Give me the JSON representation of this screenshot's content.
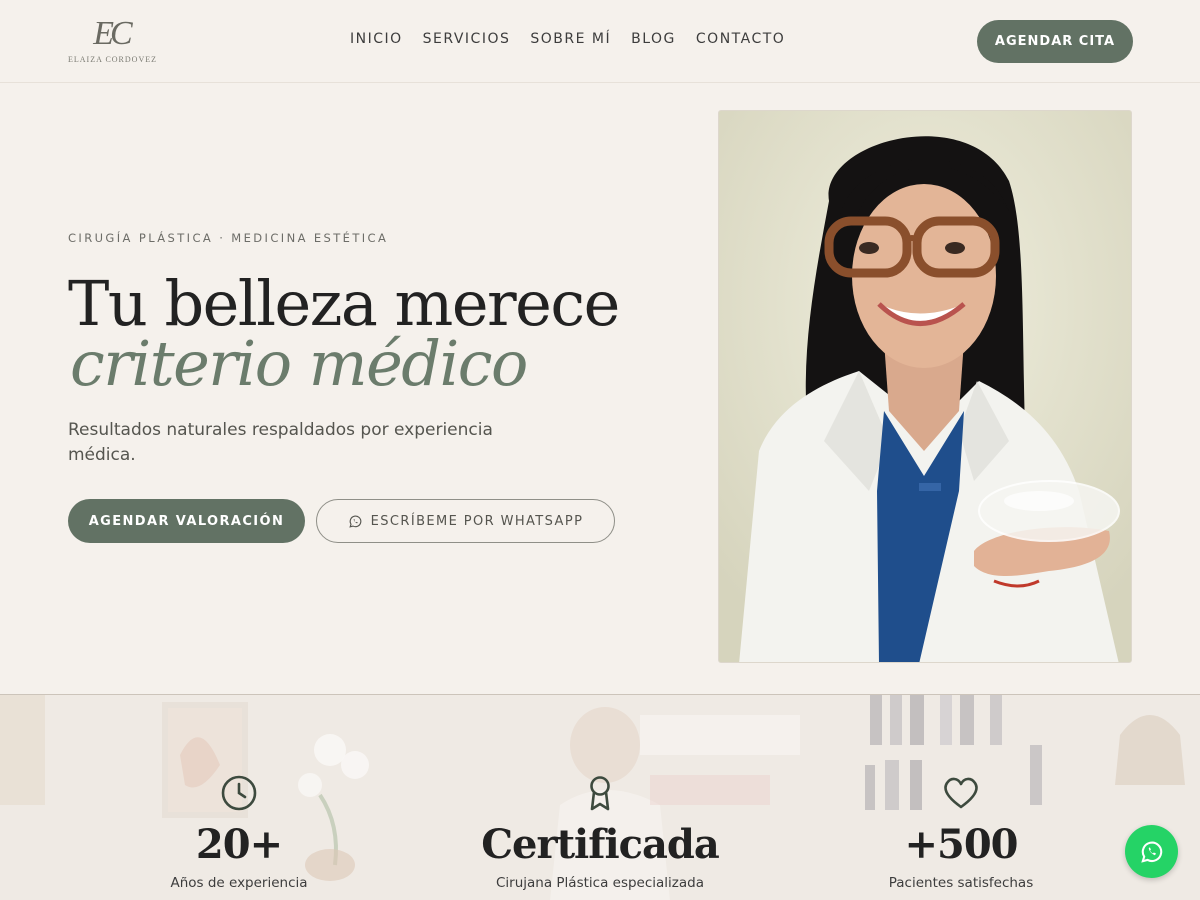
{
  "header": {
    "logo_mark": "EC",
    "logo_name": "ELAIZA CORDOVEZ",
    "nav": [
      "INICIO",
      "SERVICIOS",
      "SOBRE MÍ",
      "BLOG",
      "CONTACTO"
    ],
    "cta": "AGENDAR CITA"
  },
  "hero": {
    "eyebrow": "CIRUGÍA PLÁSTICA · MEDICINA ESTÉTICA",
    "title_line1": "Tu belleza merece",
    "title_line2": "criterio médico",
    "subtitle": "Resultados naturales respaldados por experiencia médica.",
    "primary_button": "AGENDAR VALORACIÓN",
    "secondary_button": "ESCRÍBEME POR WHATSAPP",
    "secondary_icon": "whatsapp-icon"
  },
  "stats": [
    {
      "icon": "clock-icon",
      "value": "20+",
      "label": "Años de experiencia"
    },
    {
      "icon": "award-icon",
      "value": "Certificada",
      "label": "Cirujana Plástica especializada"
    },
    {
      "icon": "heart-icon",
      "value": "+500",
      "label": "Pacientes satisfechas"
    }
  ],
  "floating": {
    "icon": "whatsapp-icon"
  },
  "colors": {
    "accent": "#627264",
    "accent_italic": "#6b7c6c",
    "background": "#f5f1ec",
    "whatsapp": "#25d366"
  }
}
